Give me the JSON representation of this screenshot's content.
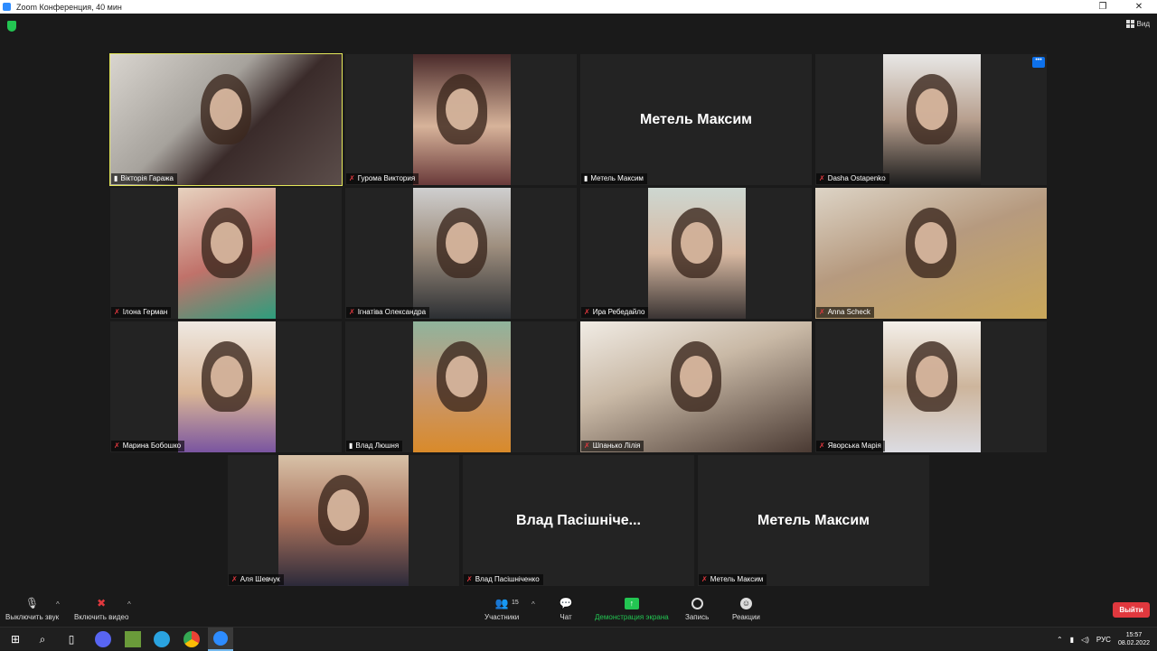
{
  "window": {
    "title": "Zoom Конференция, 40 мин"
  },
  "topbar": {
    "view_label": "Вид"
  },
  "tiles": [
    {
      "name": "Вікторія Гаража",
      "bg": "bg-teacher",
      "mode": "full",
      "active": true,
      "muted": false
    },
    {
      "name": "Гурома Виктория",
      "bg": "bg-a",
      "mode": "narrow",
      "muted": true
    },
    {
      "name": "Метель Максим",
      "center_name": "Метель Максим",
      "mode": "none",
      "muted": false
    },
    {
      "name": "Dasha Ostapenko",
      "bg": "bg-b",
      "mode": "narrow",
      "muted": true,
      "more": true
    },
    {
      "name": "Ілона Герман",
      "bg": "bg-c",
      "mode": "narrow",
      "muted": true
    },
    {
      "name": "Ігнатіва Олександра",
      "bg": "bg-d",
      "mode": "narrow",
      "muted": true
    },
    {
      "name": "Ира Ребедайло",
      "bg": "bg-e",
      "mode": "narrow",
      "muted": true
    },
    {
      "name": "Anna Scheck",
      "bg": "bg-f",
      "mode": "full",
      "muted": true
    },
    {
      "name": "Марина Бобошко",
      "bg": "bg-g",
      "mode": "narrow",
      "muted": true
    },
    {
      "name": "Влад Люшня",
      "bg": "bg-h",
      "mode": "narrow",
      "muted": false
    },
    {
      "name": "Шпанько Лілія",
      "bg": "bg-i",
      "mode": "full",
      "muted": true
    },
    {
      "name": "Яворська Марія",
      "bg": "bg-j",
      "mode": "narrow",
      "muted": true
    },
    {
      "name": "Аля Шевчук",
      "bg": "bg-k",
      "mode": "wide",
      "muted": true
    },
    {
      "name": "Влад Пасішніченко",
      "center_name": "Влад  Пасішніче...",
      "mode": "none",
      "muted": true
    },
    {
      "name": "Метель Максим",
      "center_name": "Метель Максим",
      "mode": "none",
      "muted": true
    }
  ],
  "toolbar": {
    "mute_label": "Выключить звук",
    "video_label": "Включить видео",
    "participants_label": "Участники",
    "participants_count": "15",
    "chat_label": "Чат",
    "share_label": "Демонстрация экрана",
    "record_label": "Запись",
    "reactions_label": "Реакции",
    "leave_label": "Выйти"
  },
  "taskbar": {
    "lang": "РУС",
    "time": "15:57",
    "date": "08.02.2022"
  },
  "colors": {
    "active_speaker": "#e5e85a",
    "share_green": "#23c552",
    "leave_red": "#e0383e",
    "more_blue": "#0e71eb"
  }
}
